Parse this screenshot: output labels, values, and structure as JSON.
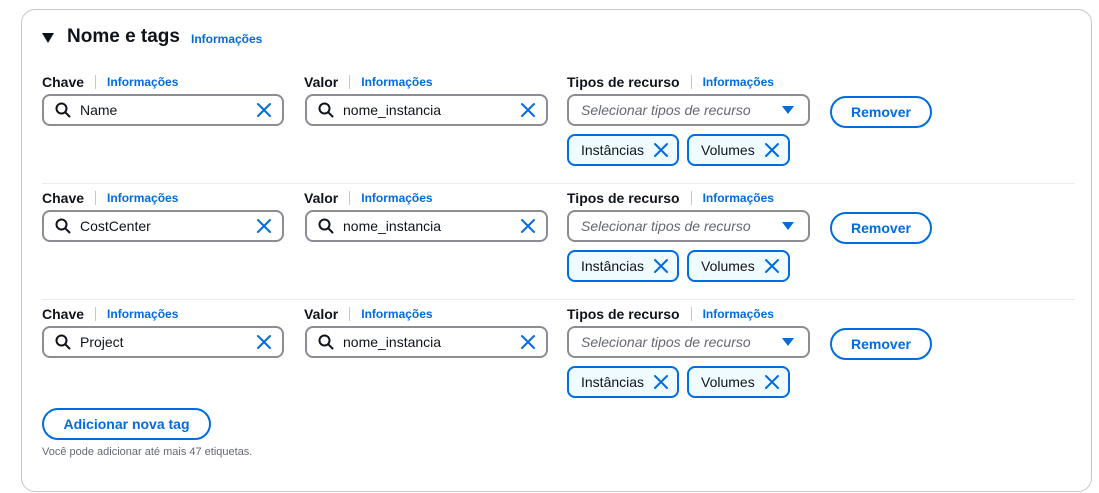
{
  "section": {
    "title": "Nome e tags",
    "info_link": "Informações"
  },
  "labels": {
    "key": "Chave",
    "value": "Valor",
    "resource_types": "Tipos de recurso",
    "info": "Informações"
  },
  "resource_placeholder": "Selecionar tipos de recurso",
  "remove_label": "Remover",
  "tags": [
    {
      "key": "Name",
      "value": "nome_instancia",
      "resource_types": [
        "Instâncias",
        "Volumes"
      ]
    },
    {
      "key": "CostCenter",
      "value": "nome_instancia",
      "resource_types": [
        "Instâncias",
        "Volumes"
      ]
    },
    {
      "key": "Project",
      "value": "nome_instancia",
      "resource_types": [
        "Instâncias",
        "Volumes"
      ]
    }
  ],
  "add_button_label": "Adicionar nova tag",
  "hint": "Você pode adicionar até mais 47 etiquetas.",
  "colors": {
    "accent": "#006ce0",
    "text": "#0f141a",
    "border": "#8c8c94",
    "token_bg": "#f0fbff"
  },
  "icons": {
    "section_toggle": "caret-down-icon",
    "search": "search-icon",
    "clear": "close-icon",
    "dropdown": "triangle-down-icon",
    "token_remove": "close-icon"
  }
}
